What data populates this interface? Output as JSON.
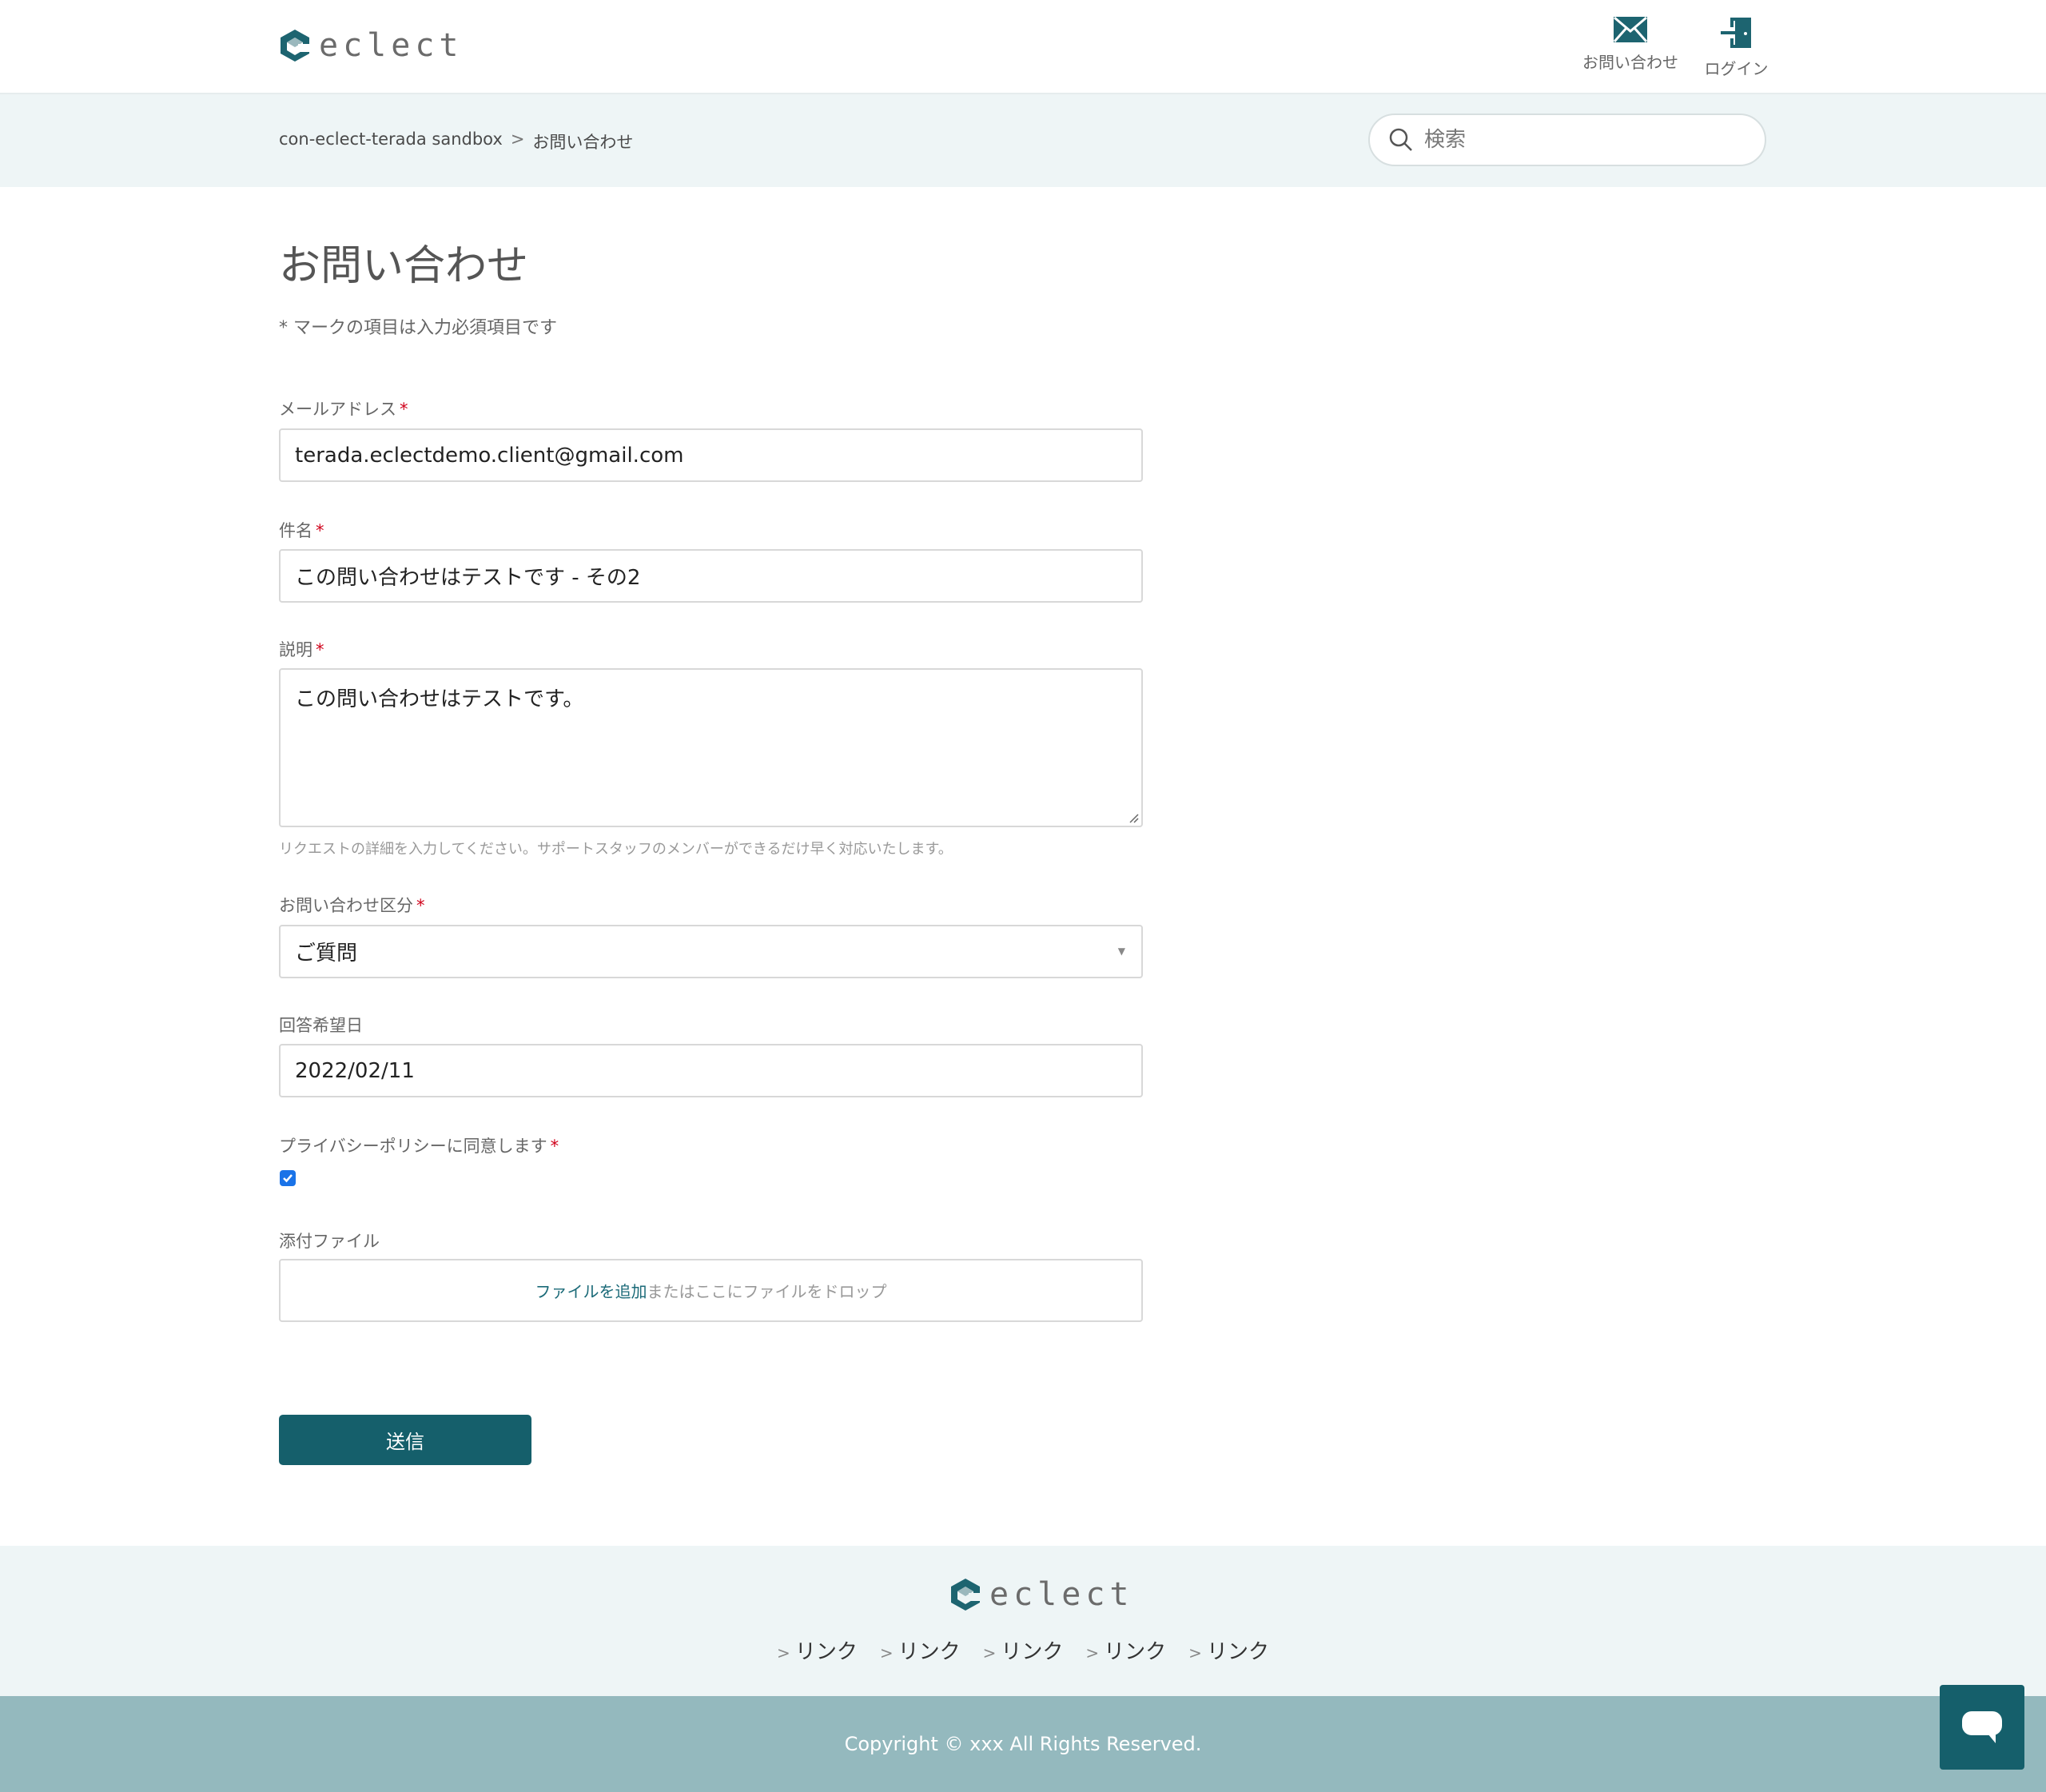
{
  "header": {
    "brand": "eclect",
    "contact_label": "お問い合わせ",
    "login_label": "ログイン"
  },
  "breadcrumb": {
    "items": [
      "con-eclect-terada sandbox",
      "お問い合わせ"
    ],
    "separator": ">"
  },
  "search": {
    "placeholder": "検索"
  },
  "page": {
    "title": "お問い合わせ",
    "required_note": "* マークの項目は入力必須項目です"
  },
  "form": {
    "email": {
      "label": "メールアドレス",
      "required": "*",
      "value": "terada.eclectdemo.client@gmail.com"
    },
    "subject": {
      "label": "件名",
      "required": "*",
      "value": "この問い合わせはテストです - その2"
    },
    "description": {
      "label": "説明",
      "required": "*",
      "value": "この問い合わせはテストです。",
      "hint": "リクエストの詳細を入力してください。サポートスタッフのメンバーができるだけ早く対応いたします。"
    },
    "category": {
      "label": "お問い合わせ区分",
      "required": "*",
      "value": "ご質問"
    },
    "due_date": {
      "label": "回答希望日",
      "value": "2022/02/11"
    },
    "privacy": {
      "label": "プライバシーポリシーに同意します",
      "required": "*",
      "checked": true
    },
    "attachment": {
      "label": "添付ファイル",
      "add_label": "ファイルを追加",
      "drop_text": "またはここにファイルをドロップ"
    },
    "submit_label": "送信"
  },
  "footer": {
    "brand": "eclect",
    "links": [
      "リンク",
      "リンク",
      "リンク",
      "リンク",
      "リンク"
    ],
    "copyright": "Copyright © xxx All Rights Reserved."
  },
  "colors": {
    "accent": "#155f6b",
    "band_bg": "#eef5f6",
    "copyright_bg": "#94b9be",
    "required": "#d0021b"
  },
  "icons": [
    "logo-mark-icon",
    "mail-icon",
    "login-door-icon",
    "search-icon",
    "chevron-right-icon",
    "chat-icon"
  ]
}
